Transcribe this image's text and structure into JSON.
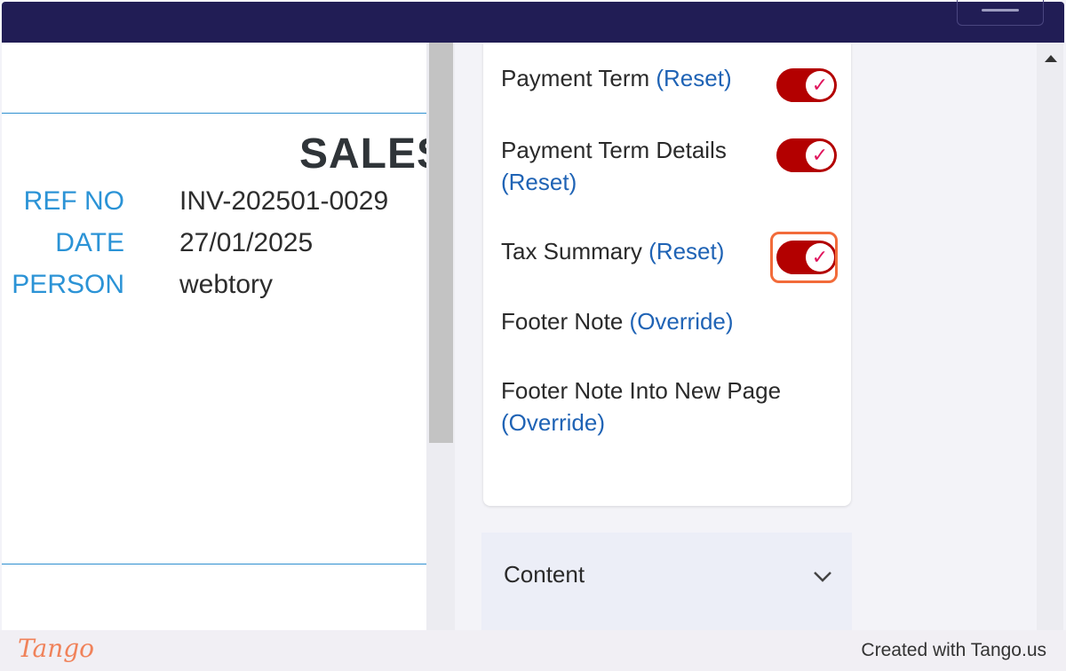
{
  "preview": {
    "title": "SALES",
    "meta": [
      {
        "label": "REF NO",
        "value": "INV-202501-0029"
      },
      {
        "label": "DATE",
        "value": "27/01/2025"
      },
      {
        "label": "PERSON",
        "value": "webtory"
      }
    ]
  },
  "settings": {
    "options": [
      {
        "name": "Payment Term",
        "link": "(Reset)",
        "toggle": true
      },
      {
        "name": "Payment Term Details",
        "link": "(Reset)",
        "toggle": true
      },
      {
        "name": "Tax Summary",
        "link": "(Reset)",
        "toggle": true
      },
      {
        "name": "Footer Note",
        "link": "(Override)",
        "toggle": false
      },
      {
        "name": "Footer Note Into New Page",
        "link": "(Override)",
        "toggle": false
      }
    ],
    "checkmark": "✓"
  },
  "content_section": {
    "label": "Content",
    "icon": "chevron-down-icon"
  },
  "footer": {
    "brand": "Tango",
    "credit": "Created with Tango.us"
  },
  "colors": {
    "topbar": "#211d55",
    "toggle_on": "#b30000",
    "link": "#1f63b5",
    "label": "#2b93d6",
    "highlight": "#f26b3a"
  }
}
